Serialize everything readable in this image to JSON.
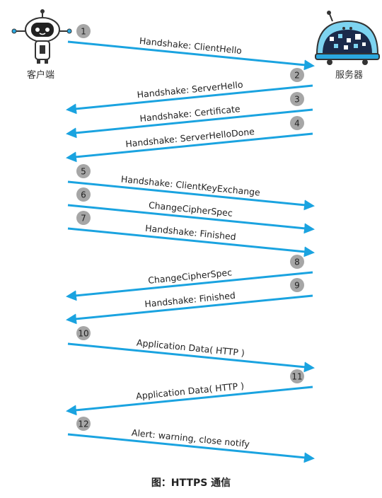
{
  "actors": {
    "client": {
      "label": "客户端",
      "icon": "robot-icon"
    },
    "server": {
      "label": "服务器",
      "icon": "server-robot-icon"
    }
  },
  "messages": [
    {
      "step": "1",
      "label": "Handshake: ClientHello",
      "direction": "client-to-server"
    },
    {
      "step": "2",
      "label": "Handshake: ServerHello",
      "direction": "server-to-client"
    },
    {
      "step": "3",
      "label": "Handshake: Certificate",
      "direction": "server-to-client"
    },
    {
      "step": "4",
      "label": "Handshake: ServerHelloDone",
      "direction": "server-to-client"
    },
    {
      "step": "5",
      "label": "Handshake: ClientKeyExchange",
      "direction": "client-to-server"
    },
    {
      "step": "6",
      "label": "ChangeCipherSpec",
      "direction": "client-to-server"
    },
    {
      "step": "7",
      "label": "Handshake: Finished",
      "direction": "client-to-server"
    },
    {
      "step": "8",
      "label": "ChangeCipherSpec",
      "direction": "server-to-client"
    },
    {
      "step": "9",
      "label": "Handshake: Finished",
      "direction": "server-to-client"
    },
    {
      "step": "10",
      "label": "Application Data( HTTP )",
      "direction": "client-to-server"
    },
    {
      "step": "11",
      "label": "Application Data( HTTP )",
      "direction": "server-to-client"
    },
    {
      "step": "12",
      "label": "Alert: warning, close notify",
      "direction": "client-to-server"
    }
  ],
  "caption": "图：HTTPS 通信",
  "colors": {
    "arrow": "#1aa3e0",
    "badge": "#a6a6a6",
    "text": "#222222"
  }
}
